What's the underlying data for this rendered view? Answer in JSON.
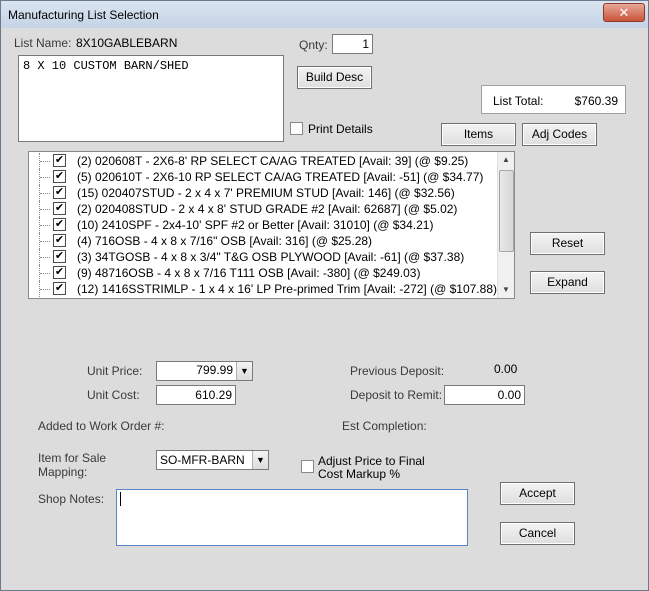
{
  "window": {
    "title": "Manufacturing List Selection",
    "close_glyph": "✕"
  },
  "header": {
    "list_name_label": "List Name:",
    "list_name_value": "8X10GABLEBARN",
    "qnty_label": "Qnty:",
    "qnty_value": "1",
    "description_value": "8 X 10 CUSTOM BARN/SHED",
    "build_desc_label": "Build Desc",
    "list_total_label": "List Total:",
    "list_total_value": "$760.39",
    "print_details_label": "Print Details",
    "items_label": "Items",
    "adj_codes_label": "Adj Codes"
  },
  "items": [
    {
      "checked": true,
      "text": "(2) 020608T    - 2X6-8' RP SELECT CA/AG TREATED [Avail: 39]    (@ $9.25)"
    },
    {
      "checked": true,
      "text": "(5) 020610T    - 2X6-10 RP SELECT CA/AG TREATED [Avail: -51]    (@ $34.77)"
    },
    {
      "checked": true,
      "text": "(15) 020407STUD    - 2 x 4 x 7' PREMIUM STUD [Avail: 146]    (@ $32.56)"
    },
    {
      "checked": true,
      "text": "(2) 020408STUD    - 2 x 4 x 8' STUD GRADE #2 [Avail: 62687]    (@ $5.02)"
    },
    {
      "checked": true,
      "text": "(10) 2410SPF    - 2x4-10' SPF #2 or Better [Avail: 31010]    (@ $34.21)"
    },
    {
      "checked": true,
      "text": "(4) 716OSB    - 4 x 8 x 7/16\" OSB [Avail: 316]    (@ $25.28)"
    },
    {
      "checked": true,
      "text": "(3) 34TGOSB    - 4 x 8 x 3/4\" T&G OSB PLYWOOD [Avail: -61]    (@ $37.38)"
    },
    {
      "checked": true,
      "text": "(9) 48716OSB    - 4 x 8 x 7/16 T111 OSB [Avail: -380]    (@ $249.03)"
    },
    {
      "checked": true,
      "text": "(12) 1416SSTRIMLP    - 1 x 4 x 16' LP Pre-primed Trim [Avail: -272]    (@ $107.88)"
    }
  ],
  "side_buttons": {
    "reset_label": "Reset",
    "expand_label": "Expand"
  },
  "pricing": {
    "unit_price_label": "Unit Price:",
    "unit_price_value": "799.99",
    "unit_cost_label": "Unit Cost:",
    "unit_cost_value": "610.29",
    "previous_deposit_label": "Previous Deposit:",
    "previous_deposit_value": "0.00",
    "deposit_to_remit_label": "Deposit to Remit:",
    "deposit_to_remit_value": "0.00",
    "work_order_label": "Added to Work Order #:",
    "est_completion_label": "Est Completion:",
    "item_for_sale_label_1": "Item for Sale",
    "item_for_sale_label_2": "Mapping:",
    "item_for_sale_value": "SO-MFR-BARN",
    "adjust_price_label_1": "Adjust Price to Final",
    "adjust_price_label_2": "Cost Markup %"
  },
  "footer": {
    "shop_notes_label": "Shop Notes:",
    "shop_notes_value": "",
    "accept_label": "Accept",
    "cancel_label": "Cancel"
  },
  "icons": {
    "check": "✔",
    "dropdown": "▼",
    "scroll_up": "▲",
    "scroll_down": "▼"
  }
}
